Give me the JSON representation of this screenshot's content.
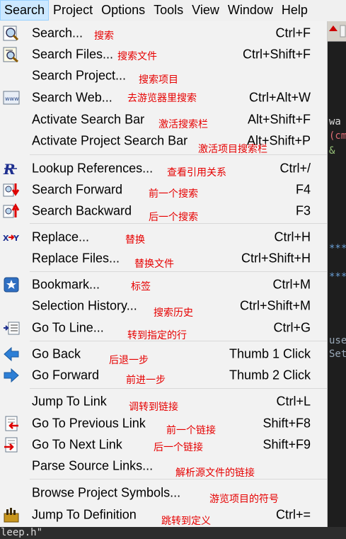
{
  "menubar": {
    "items": [
      "Search",
      "Project",
      "Options",
      "Tools",
      "View",
      "Window",
      "Help"
    ]
  },
  "editor_peek": {
    "lines": [
      {
        "text": "wa",
        "color": "#dcdcdc"
      },
      {
        "text": "(cm",
        "color": "#e06c75"
      },
      {
        "text": "&",
        "color": "#98c379"
      },
      {
        "text": "***",
        "color": "#6a9fd6"
      },
      {
        "text": "***",
        "color": "#6a9fd6"
      },
      {
        "text": "use",
        "color": "#9aa9b8"
      },
      {
        "text": "Set",
        "color": "#9aa9b8"
      }
    ]
  },
  "status_text": "leep.h\"",
  "menu": {
    "items": [
      {
        "label": "Search...",
        "shortcut": "Ctrl+F",
        "note": "搜索",
        "icon": "search-magnifier-icon"
      },
      {
        "label": "Search Files...",
        "shortcut": "Ctrl+Shift+F",
        "note": "搜索文件",
        "icon": "search-files-icon"
      },
      {
        "label": "Search Project...",
        "shortcut": "",
        "note": "搜索项目",
        "icon": ""
      },
      {
        "label": "Search Web...",
        "shortcut": "Ctrl+Alt+W",
        "note": "去游览器里搜索",
        "icon": "web-icon"
      },
      {
        "label": "Activate Search Bar",
        "shortcut": "Alt+Shift+F",
        "note": "激活搜索栏",
        "icon": ""
      },
      {
        "label": "Activate Project Search Bar",
        "shortcut": "Alt+Shift+P",
        "note": "激活项目搜索栏",
        "icon": ""
      },
      {
        "label": "Lookup References...",
        "shortcut": "Ctrl+/",
        "note": "查看引用关系",
        "icon": "references-icon"
      },
      {
        "label": "Search Forward",
        "shortcut": "F4",
        "note": "前一个搜索",
        "icon": "search-forward-icon"
      },
      {
        "label": "Search Backward",
        "shortcut": "F3",
        "note": "后一个搜索",
        "icon": "search-backward-icon"
      },
      {
        "label": "Replace...",
        "shortcut": "Ctrl+H",
        "note": "替换",
        "icon": "replace-icon"
      },
      {
        "label": "Replace Files...",
        "shortcut": "Ctrl+Shift+H",
        "note": "替换文件",
        "icon": ""
      },
      {
        "label": "Bookmark...",
        "shortcut": "Ctrl+M",
        "note": "标签",
        "icon": "bookmark-icon"
      },
      {
        "label": "Selection History...",
        "shortcut": "Ctrl+Shift+M",
        "note": "搜索历史",
        "icon": ""
      },
      {
        "label": "Go To Line...",
        "shortcut": "Ctrl+G",
        "note": "转到指定的行",
        "icon": "goto-line-icon"
      },
      {
        "label": "Go Back",
        "shortcut": "Thumb 1 Click",
        "note": "后退一步",
        "icon": "back-arrow-icon"
      },
      {
        "label": "Go Forward",
        "shortcut": "Thumb 2 Click",
        "note": "前进一步",
        "icon": "forward-arrow-icon"
      },
      {
        "label": "Jump To Link",
        "shortcut": "Ctrl+L",
        "note": "调转到链接",
        "icon": ""
      },
      {
        "label": "Go To Previous Link",
        "shortcut": "Shift+F8",
        "note": "前一个链接",
        "icon": "previous-link-icon"
      },
      {
        "label": "Go To Next Link",
        "shortcut": "Shift+F9",
        "note": "后一个链接",
        "icon": "next-link-icon"
      },
      {
        "label": "Parse Source Links...",
        "shortcut": "",
        "note": "解析源文件的链接",
        "icon": ""
      },
      {
        "label": "Browse Project Symbols...",
        "shortcut": "",
        "note": "游览项目的符号",
        "icon": ""
      },
      {
        "label": "Jump To Definition",
        "shortcut": "Ctrl+=",
        "note": "跳转到定义",
        "icon": "jump-definition-icon"
      }
    ]
  },
  "colors": {
    "menubar_active_bg": "#cce8ff",
    "annotation": "#e60000",
    "menu_bg": "#f2f2f2"
  }
}
